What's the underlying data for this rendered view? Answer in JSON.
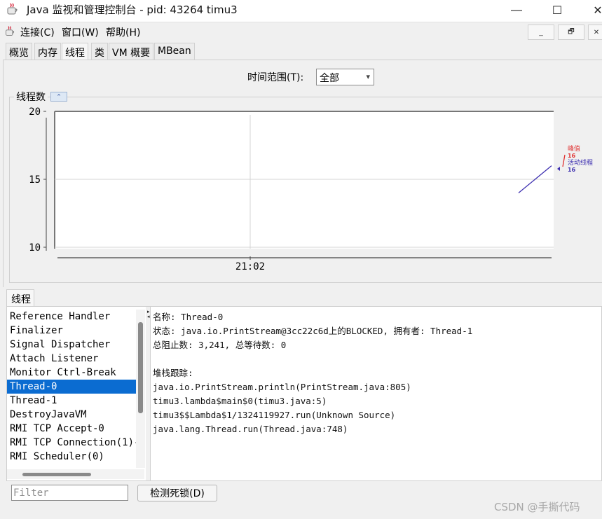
{
  "window": {
    "title": "Java 监视和管理控制台 - pid: 43264 timu3",
    "minimize_glyph": "—",
    "maximize_glyph": "☐",
    "close_glyph": "✕",
    "icon": "java-cup-icon"
  },
  "menu": {
    "items": [
      "连接(C)",
      "窗口(W)",
      "帮助(H)"
    ],
    "mdi_buttons": [
      "_",
      "🗗",
      "✕"
    ]
  },
  "tabs": [
    "概览",
    "内存",
    "线程",
    "类",
    "VM 概要",
    "MBean"
  ],
  "active_tab": "线程",
  "time_range": {
    "label": "时间范围(T):",
    "selected": "全部",
    "arrow": "▾"
  },
  "thread_panel": {
    "title": "线程数",
    "collapse_glyph": "⌃"
  },
  "chart_data": {
    "type": "line",
    "x_tick_labels": [
      "21:02"
    ],
    "y_tick_labels": [
      "20",
      "15",
      "10"
    ],
    "ylim": [
      10,
      20
    ],
    "grid": true,
    "series": [
      {
        "name": "峰值",
        "color": "#e03232",
        "latest": 16
      },
      {
        "name": "活动线程",
        "color": "#3d2fb0",
        "latest": 16,
        "points": [
          [
            0,
            14
          ],
          [
            1,
            16
          ]
        ]
      }
    ],
    "legend_values": [
      "16",
      "16"
    ]
  },
  "lower": {
    "tab_label": "线程",
    "threads": [
      "Reference Handler",
      "Finalizer",
      "Signal Dispatcher",
      "Attach Listener",
      "Monitor Ctrl-Break",
      "Thread-0",
      "Thread-1",
      "DestroyJavaVM",
      "RMI TCP Accept-0",
      "RMI TCP Connection(1)-",
      "RMI Scheduler(0)"
    ],
    "selected_thread": "Thread-0",
    "details": [
      "名称: Thread-0",
      "状态: java.io.PrintStream@3cc22c6d上的BLOCKED, 拥有者: Thread-1",
      "总阻止数: 3,241, 总等待数: 0",
      "",
      "堆栈跟踪:",
      "java.io.PrintStream.println(PrintStream.java:805)",
      "timu3.lambda$main$0(timu3.java:5)",
      "timu3$$Lambda$1/1324119927.run(Unknown Source)",
      "java.lang.Thread.run(Thread.java:748)"
    ]
  },
  "filter_placeholder": "Filter",
  "deadlock_button": "检测死锁(D)",
  "watermark": "CSDN @手撕代码"
}
